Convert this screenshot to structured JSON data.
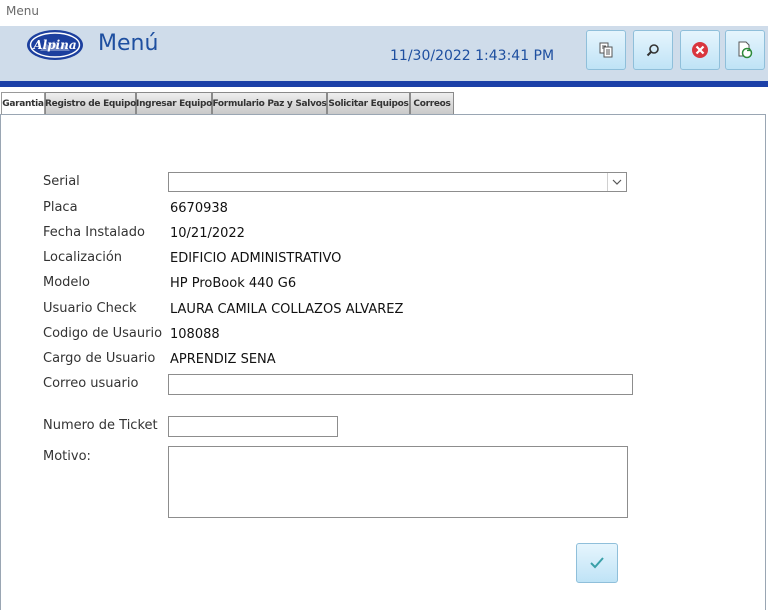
{
  "window": {
    "title": "Menu"
  },
  "header": {
    "logo_text": "Alpina",
    "title": "Menú",
    "datetime": "11/30/2022 1:43:41 PM",
    "buttons": [
      {
        "name": "copy-button",
        "icon": "copy-icon"
      },
      {
        "name": "search-button",
        "icon": "search-icon"
      },
      {
        "name": "close-button",
        "icon": "close-icon"
      },
      {
        "name": "refresh-button",
        "icon": "refresh-document-icon"
      }
    ]
  },
  "tabs": [
    {
      "label": "Garantia",
      "active": true
    },
    {
      "label": "Registro de Equipo",
      "active": false
    },
    {
      "label": "Ingresar Equipo",
      "active": false
    },
    {
      "label": "Formulario Paz y Salvos",
      "active": false
    },
    {
      "label": "Solicitar Equipos",
      "active": false
    },
    {
      "label": "Correos",
      "active": false
    }
  ],
  "form": {
    "serial_label": "Serial",
    "serial_value": "",
    "placa_label": "Placa",
    "placa_value": "6670938",
    "fecha_label": "Fecha Instalado",
    "fecha_value": "10/21/2022",
    "localizacion_label": "Localización",
    "localizacion_value": "EDIFICIO ADMINISTRATIVO",
    "modelo_label": "Modelo",
    "modelo_value": "HP ProBook 440 G6",
    "usuario_check_label": "Usuario Check",
    "usuario_check_value": "LAURA CAMILA COLLAZOS ALVAREZ",
    "codigo_label": "Codigo de Usaurio",
    "codigo_value": "108088",
    "cargo_label": "Cargo de Usuario",
    "cargo_value": "APRENDIZ SENA",
    "correo_label": "Correo usuario",
    "correo_value": "",
    "ticket_label": "Numero de Ticket",
    "ticket_value": "",
    "motivo_label": "Motivo:",
    "motivo_value": ""
  },
  "colors": {
    "accent": "#1e4fa0",
    "header_bg": "#cfdcea",
    "strip": "#1c40a8",
    "button_bg": "#bfe3f6"
  }
}
